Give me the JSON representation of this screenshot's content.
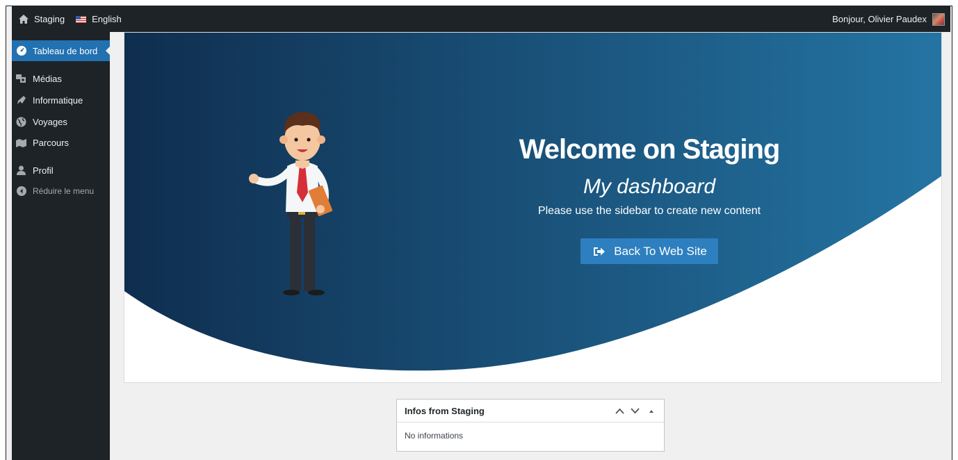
{
  "admin_bar": {
    "site_name": "Staging",
    "language": "English",
    "greeting": "Bonjour, Olivier Paudex"
  },
  "sidebar": {
    "items": [
      {
        "label": "Tableau de bord",
        "icon": "dashboard-icon",
        "active": true
      },
      {
        "label": "Médias",
        "icon": "media-icon"
      },
      {
        "label": "Informatique",
        "icon": "plug-icon"
      },
      {
        "label": "Voyages",
        "icon": "globe-icon"
      },
      {
        "label": "Parcours",
        "icon": "map-icon"
      },
      {
        "label": "Profil",
        "icon": "user-icon"
      },
      {
        "label": "Réduire le menu",
        "icon": "collapse-icon"
      }
    ]
  },
  "hero": {
    "title": "Welcome on Staging",
    "subtitle": "My dashboard",
    "description": "Please use the sidebar to create new content",
    "button_label": "Back To Web Site",
    "gradient_start": "#0f2e4f",
    "gradient_end": "#2474a3",
    "button_color": "#2d7fbf"
  },
  "widget": {
    "title": "Infos from Staging",
    "body": "No informations"
  },
  "colors": {
    "admin_bar": "#1d2327",
    "accent": "#2271b1",
    "background": "#f0f0f1"
  }
}
